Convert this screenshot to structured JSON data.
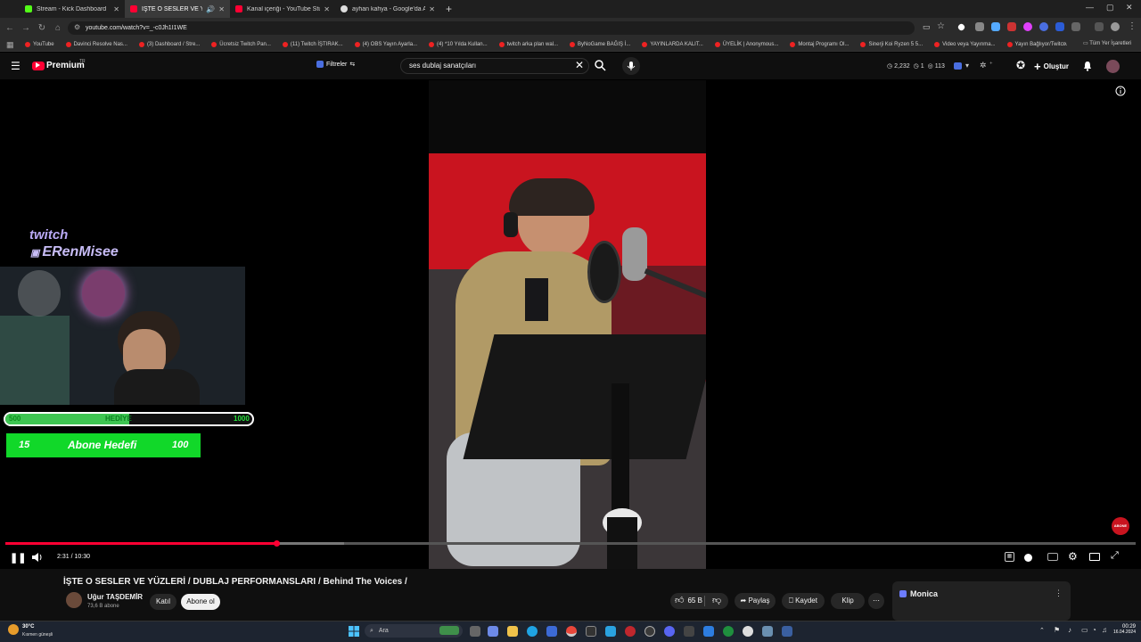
{
  "browser": {
    "tabs": [
      {
        "title": "Stream - Kick Dashboard",
        "color": "#53fc18"
      },
      {
        "title": "İŞTE O SESLER VE YÜZLERİ",
        "color": "#ff0033"
      },
      {
        "title": "Kanal içeriği - YouTube Studio",
        "color": "#ff0033"
      },
      {
        "title": "ayhan kahya - Google'da Ara",
        "color": "#dddddd"
      }
    ],
    "url": "youtube.com/watch?v=_-c0Jh1I1WE",
    "bookmarks": [
      "YouTube",
      "Davinci Resolve Nas...",
      "(3) Dashboard / Stre...",
      "Ücretsiz Twitch Pan...",
      "(11) Twitch İŞTIRAK...",
      "(4) OBS Yayın Ayarla...",
      "(4) *10 Yılda Kullan...",
      "twitch arka plan wal...",
      "ByNoGame BAĞIŞ İ...",
      "YAYINLARDA KALIT...",
      "ÜYELİK | Anonymous...",
      "Montaj Programı Ol...",
      "Sinerji Koi Ryzen 5 5...",
      "Video veya Yayınma...",
      "Yayın Bağlıyor/Twitc..."
    ],
    "all_bookmarks_label": "Tüm Yer İşaretleri"
  },
  "youtube": {
    "logo_text": "Premium",
    "logo_sup": "TR",
    "filters_label": "Filtreler",
    "search_value": "ses dublaj sanatçıları",
    "stats": {
      "views": "2,232",
      "a": "1",
      "b": "113"
    },
    "create_label": "Oluştur"
  },
  "overlay": {
    "twitch_text": "twitch",
    "channel_name": "ERenMisee",
    "hedye": {
      "current": "500",
      "label": "HEDİYE",
      "goal": "1000",
      "fraction": 0.5
    },
    "abone": {
      "current": "15",
      "label": "Abone Hedefi",
      "goal": "100"
    }
  },
  "player": {
    "time": "2:31 / 10:30",
    "progress": 0.24
  },
  "video": {
    "title": "İŞTE O SESLER VE YÜZLERİ / DUBLAJ PERFORMANSLARI / Behind The Voices /",
    "channel": "Uğur TAŞDEMİR",
    "subs": "73,6 B abone",
    "join_label": "Katıl",
    "subscribe_label": "Abone ol",
    "likes": "65 B",
    "share_label": "Paylaş",
    "save_label": "Kaydet",
    "clip_label": "Klip"
  },
  "side": {
    "monica_label": "Monica"
  },
  "taskbar": {
    "weather_temp": "30°C",
    "weather_desc": "Kısmen güneşli",
    "search_placeholder": "Ara",
    "time": "00:29",
    "date": "16.04.2024"
  }
}
